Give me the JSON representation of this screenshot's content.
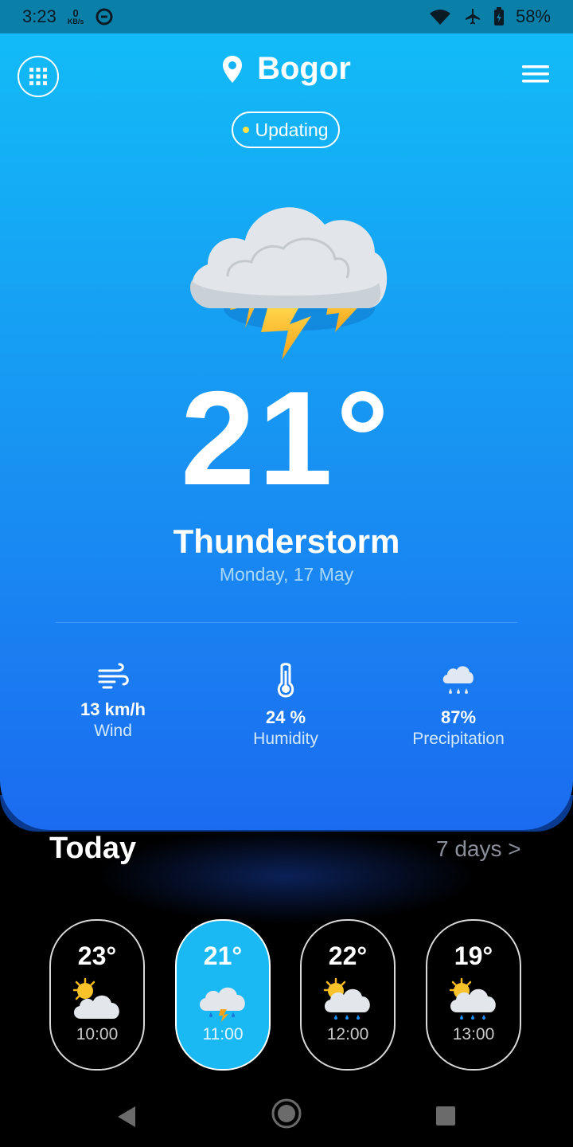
{
  "status_bar": {
    "time": "3:23",
    "net_speed_value": "0",
    "net_speed_unit": "KB/s",
    "battery": "58%",
    "icons": [
      "data-saver-icon",
      "wifi-icon",
      "airplane-icon",
      "battery-icon"
    ]
  },
  "header": {
    "city": "Bogor",
    "status": "Updating",
    "status_dot_color": "#ffe14a"
  },
  "current": {
    "temperature": "21°",
    "condition": "Thunderstorm",
    "date": "Monday, 17 May",
    "icon": "thunderstorm-icon"
  },
  "stats": [
    {
      "icon": "wind-icon",
      "value": "13 km/h",
      "label": "Wind"
    },
    {
      "icon": "thermometer-icon",
      "value": "24 %",
      "label": "Humidity"
    },
    {
      "icon": "rain-cloud-icon",
      "value": "87%",
      "label": "Precipitation"
    }
  ],
  "today": {
    "title": "Today",
    "link": "7 days >",
    "hours": [
      {
        "temp": "23°",
        "time": "10:00",
        "icon": "partly-cloudy-icon",
        "active": false
      },
      {
        "temp": "21°",
        "time": "11:00",
        "icon": "thunder-rain-icon",
        "active": true
      },
      {
        "temp": "22°",
        "time": "12:00",
        "icon": "sun-rain-icon",
        "active": false
      },
      {
        "temp": "19°",
        "time": "13:00",
        "icon": "sun-rain-icon",
        "active": false
      }
    ]
  },
  "colors": {
    "hero_top": "#12bbf7",
    "hero_bottom": "#1b6bf0",
    "active_card": "#1ab9f3",
    "background": "#000000"
  }
}
